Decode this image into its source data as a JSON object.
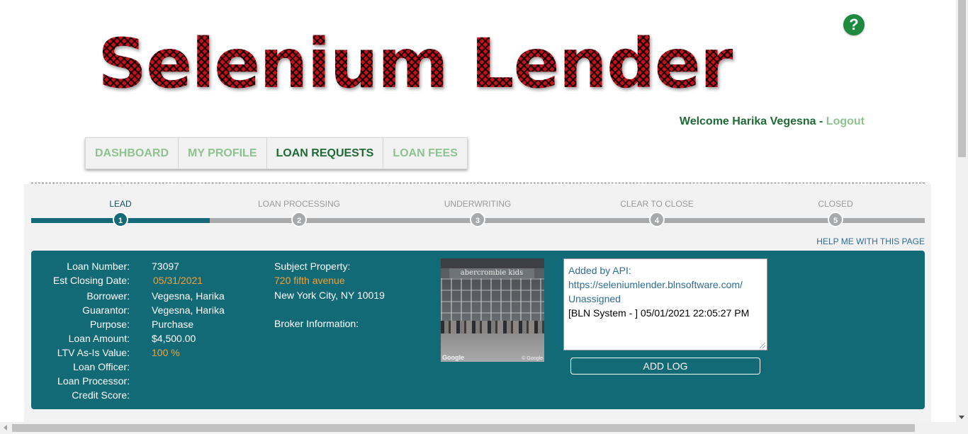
{
  "header": {
    "logo_text": "Selenium Lender",
    "help_icon": "?",
    "welcome_text": "Welcome Harika Vegesna - ",
    "logout_label": "Logout"
  },
  "nav": {
    "items": [
      {
        "label": "DASHBOARD"
      },
      {
        "label": "MY PROFILE"
      },
      {
        "label": "LOAN REQUESTS",
        "active": true
      },
      {
        "label": "LOAN FEES"
      }
    ]
  },
  "progress": {
    "current_step": 1,
    "steps": [
      {
        "label": "LEAD",
        "number": "1"
      },
      {
        "label": "LOAN PROCESSING",
        "number": "2"
      },
      {
        "label": "UNDERWRITING",
        "number": "3"
      },
      {
        "label": "CLEAR TO CLOSE",
        "number": "4"
      },
      {
        "label": "CLOSED",
        "number": "5"
      }
    ],
    "help_link": "HELP ME WITH THIS PAGE"
  },
  "loan": {
    "fields": [
      {
        "label": "Loan Number:",
        "value": "73097"
      },
      {
        "label": "Est Closing Date:",
        "value": "05/31/2021"
      },
      {
        "label": "Borrower:",
        "value": "Vegesna, Harika"
      },
      {
        "label": "Guarantor:",
        "value": "Vegesna, Harika"
      },
      {
        "label": "Purpose:",
        "value": "Purchase"
      },
      {
        "label": "Loan Amount:",
        "value": "$4,500.00"
      },
      {
        "label": "LTV As-Is Value:",
        "value": "100 %"
      },
      {
        "label": "Loan Officer:",
        "value": ""
      },
      {
        "label": "Loan Processor:",
        "value": ""
      },
      {
        "label": "Credit Score:",
        "value": ""
      }
    ],
    "subject_property_label": "Subject Property:",
    "property_street": "720 fifth avenue",
    "property_city": "New York City, NY 10019",
    "broker_label": "Broker Information:"
  },
  "streetview": {
    "sign_text": "abercrombie kids",
    "watermark": "Google",
    "watermark_small": "© Google"
  },
  "log": {
    "line1": "Added by API:",
    "line2": "https://seleniumlender.blnsoftware.com/",
    "line3": "Unassigned",
    "line4": "[BLN System - ] 05/01/2021 22:05:27 PM",
    "add_button": "ADD LOG"
  },
  "colors": {
    "brand_red": "#c4101b",
    "nav_active": "#1f6b36",
    "nav_inactive": "#8ec28e",
    "teal": "#136a77",
    "accent_orange": "#f0a23a",
    "link_blue": "#2e6d95"
  }
}
